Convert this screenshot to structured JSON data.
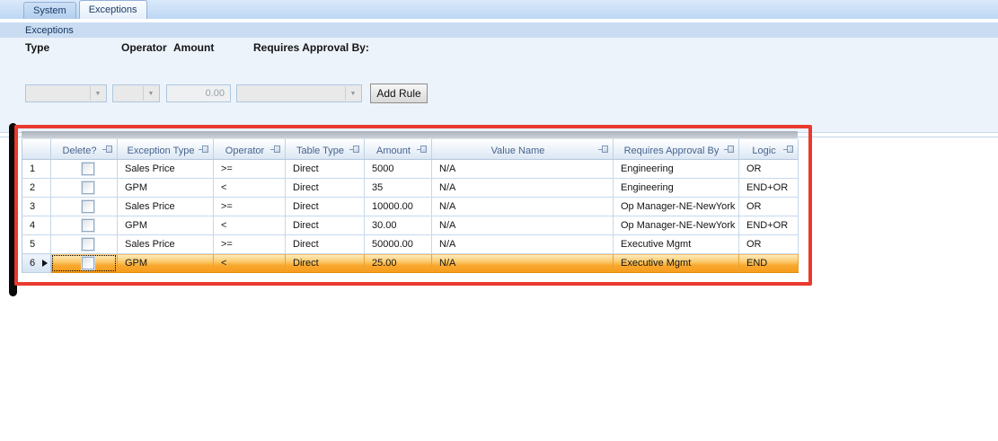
{
  "tabs": {
    "items": [
      {
        "label": "System",
        "active": false
      },
      {
        "label": "Exceptions",
        "active": true
      }
    ]
  },
  "section_header": {
    "label": "Exceptions"
  },
  "form": {
    "type_label": "Type",
    "operator_label": "Operator",
    "amount_label": "Amount",
    "approval_label": "Requires Approval By:",
    "type_dropdown_value": "",
    "operator_dropdown_value": "",
    "amount_value": "0.00",
    "approval_dropdown_value": "",
    "add_rule_label": "Add Rule"
  },
  "grid": {
    "columns": [
      {
        "key": "delete",
        "label": "Delete?"
      },
      {
        "key": "exception_type",
        "label": "Exception Type"
      },
      {
        "key": "operator",
        "label": "Operator"
      },
      {
        "key": "table_type",
        "label": "Table Type"
      },
      {
        "key": "amount",
        "label": "Amount"
      },
      {
        "key": "value_name",
        "label": "Value Name"
      },
      {
        "key": "requires_approval_by",
        "label": "Requires Approval By"
      },
      {
        "key": "logic",
        "label": "Logic"
      }
    ],
    "rows": [
      {
        "num": "1",
        "selected": false,
        "checked": false,
        "exception_type": "Sales Price",
        "operator": ">=",
        "table_type": "Direct",
        "amount": "5000",
        "value_name": "N/A",
        "requires_approval_by": "Engineering",
        "logic": "OR"
      },
      {
        "num": "2",
        "selected": false,
        "checked": false,
        "exception_type": "GPM",
        "operator": "<",
        "table_type": "Direct",
        "amount": "35",
        "value_name": "N/A",
        "requires_approval_by": "Engineering",
        "logic": "END+OR"
      },
      {
        "num": "3",
        "selected": false,
        "checked": false,
        "exception_type": "Sales Price",
        "operator": ">=",
        "table_type": "Direct",
        "amount": "10000.00",
        "value_name": "N/A",
        "requires_approval_by": "Op Manager-NE-NewYork",
        "logic": "OR"
      },
      {
        "num": "4",
        "selected": false,
        "checked": false,
        "exception_type": "GPM",
        "operator": "<",
        "table_type": "Direct",
        "amount": "30.00",
        "value_name": "N/A",
        "requires_approval_by": "Op Manager-NE-NewYork",
        "logic": "END+OR"
      },
      {
        "num": "5",
        "selected": false,
        "checked": false,
        "exception_type": "Sales Price",
        "operator": ">=",
        "table_type": "Direct",
        "amount": "50000.00",
        "value_name": "N/A",
        "requires_approval_by": "Executive Mgmt",
        "logic": "OR"
      },
      {
        "num": "6",
        "selected": true,
        "checked": false,
        "exception_type": "GPM",
        "operator": "<",
        "table_type": "Direct",
        "amount": "25.00",
        "value_name": "N/A",
        "requires_approval_by": "Executive Mgmt",
        "logic": "END"
      }
    ]
  },
  "annotations": {
    "highlight_box_color": "#e93a2e",
    "side_bar_color": "#0a0a0a"
  }
}
